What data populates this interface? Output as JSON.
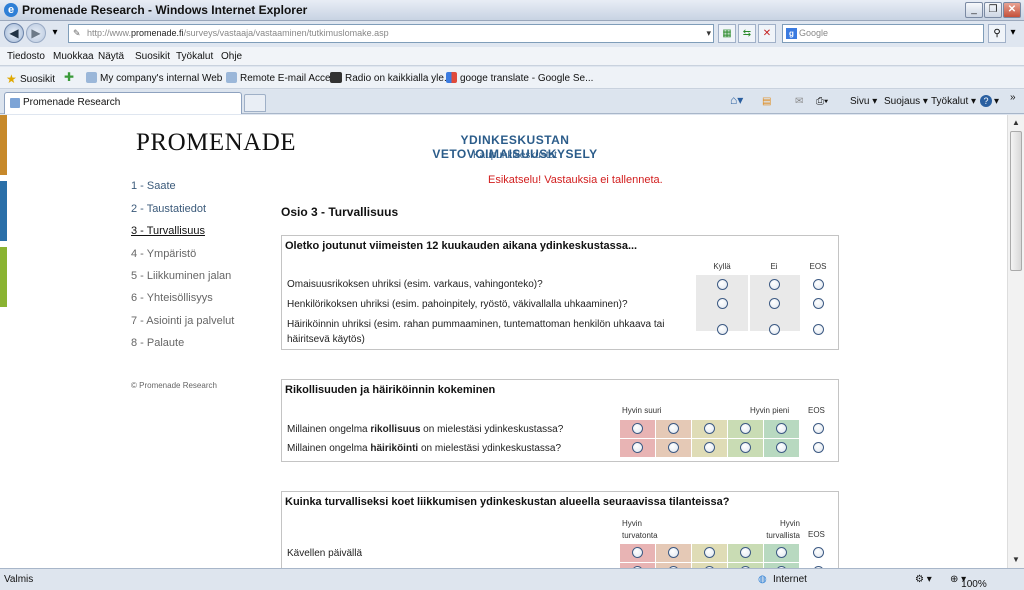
{
  "browser": {
    "window_title": "Promenade Research - Windows Internet Explorer",
    "url_prefix": "http://www.",
    "url_domain": "promenade.fi",
    "url_path": "/surveys/vastaaja/vastaaminen/tutkimuslomake.asp",
    "search_placeholder": "Google",
    "menu": [
      "Tiedosto",
      "Muokkaa",
      "Näytä",
      "Suosikit",
      "Työkalut",
      "Ohje"
    ],
    "favorites_label": "Suosikit",
    "favorites": [
      "My company's internal Web ...",
      "Remote E-mail Access",
      "Radio on kaikkialla  yle.fi",
      "googe translate - Google Se..."
    ],
    "tab_title": "Promenade Research",
    "commands": [
      "Sivu",
      "Suojaus",
      "Työkalut"
    ],
    "status": "Valmis",
    "zone": "Internet",
    "zoom": "100%"
  },
  "page": {
    "logo": "PROMENADE",
    "survey_title": "YDINKESKUSTAN VETOVOIMAISUUSKYSELY",
    "survey_subtitle": "Kaupunkikeskustat",
    "preview_notice": "Esikatselu! Vastauksia ei tallenneta.",
    "nav": [
      "1 - Saate",
      "2 - Taustatiedot",
      "3 - Turvallisuus",
      "4 - Ympäristö",
      "5 - Liikkuminen jalan",
      "6 - Yhteisöllisyys",
      "7 - Asiointi ja palvelut",
      "8 - Palaute"
    ],
    "active_nav": 2,
    "copyright": "© Promenade Research",
    "section_title": "Osio 3 - Turvallisuus"
  },
  "q1": {
    "title": "Oletko joutunut viimeisten 12 kuukauden aikana ydinkeskustassa...",
    "cols": [
      "Kyllä",
      "Ei",
      "EOS"
    ],
    "rows": [
      "Omaisuusrikoksen uhriksi (esim. varkaus, vahingonteko)?",
      "Henkilörikoksen uhriksi (esim. pahoinpitely, ryöstö, väkivallalla uhkaaminen)?",
      "Häiriköinnin uhriksi (esim. rahan pummaaminen, tuntemattoman henkilön uhkaava tai häiritsevä käytös)"
    ]
  },
  "q2": {
    "title": "Rikollisuuden ja häiriköinnin kokeminen",
    "left_label": "Hyvin suuri",
    "right_label": "Hyvin pieni",
    "eos": "EOS",
    "row1_pre": "Millainen ongelma ",
    "row1_bold": "rikollisuus",
    "row1_post": " on mielestäsi ydinkeskustassa?",
    "row2_pre": "Millainen ongelma ",
    "row2_bold": "häiriköinti",
    "row2_post": " on mielestäsi ydinkeskustassa?"
  },
  "q3": {
    "title": "Kuinka turvalliseksi koet liikkumisen ydinkeskustan alueella seuraavissa tilanteissa?",
    "left_label": "Hyvin turvatonta",
    "right_label": "Hyvin turvallista",
    "eos": "EOS",
    "rows": [
      "Kävellen päivällä"
    ]
  },
  "scale_colors": [
    "#e8b4b4",
    "#e5c9b6",
    "#dfdcb6",
    "#c9dcb4",
    "#b8d9c0"
  ]
}
